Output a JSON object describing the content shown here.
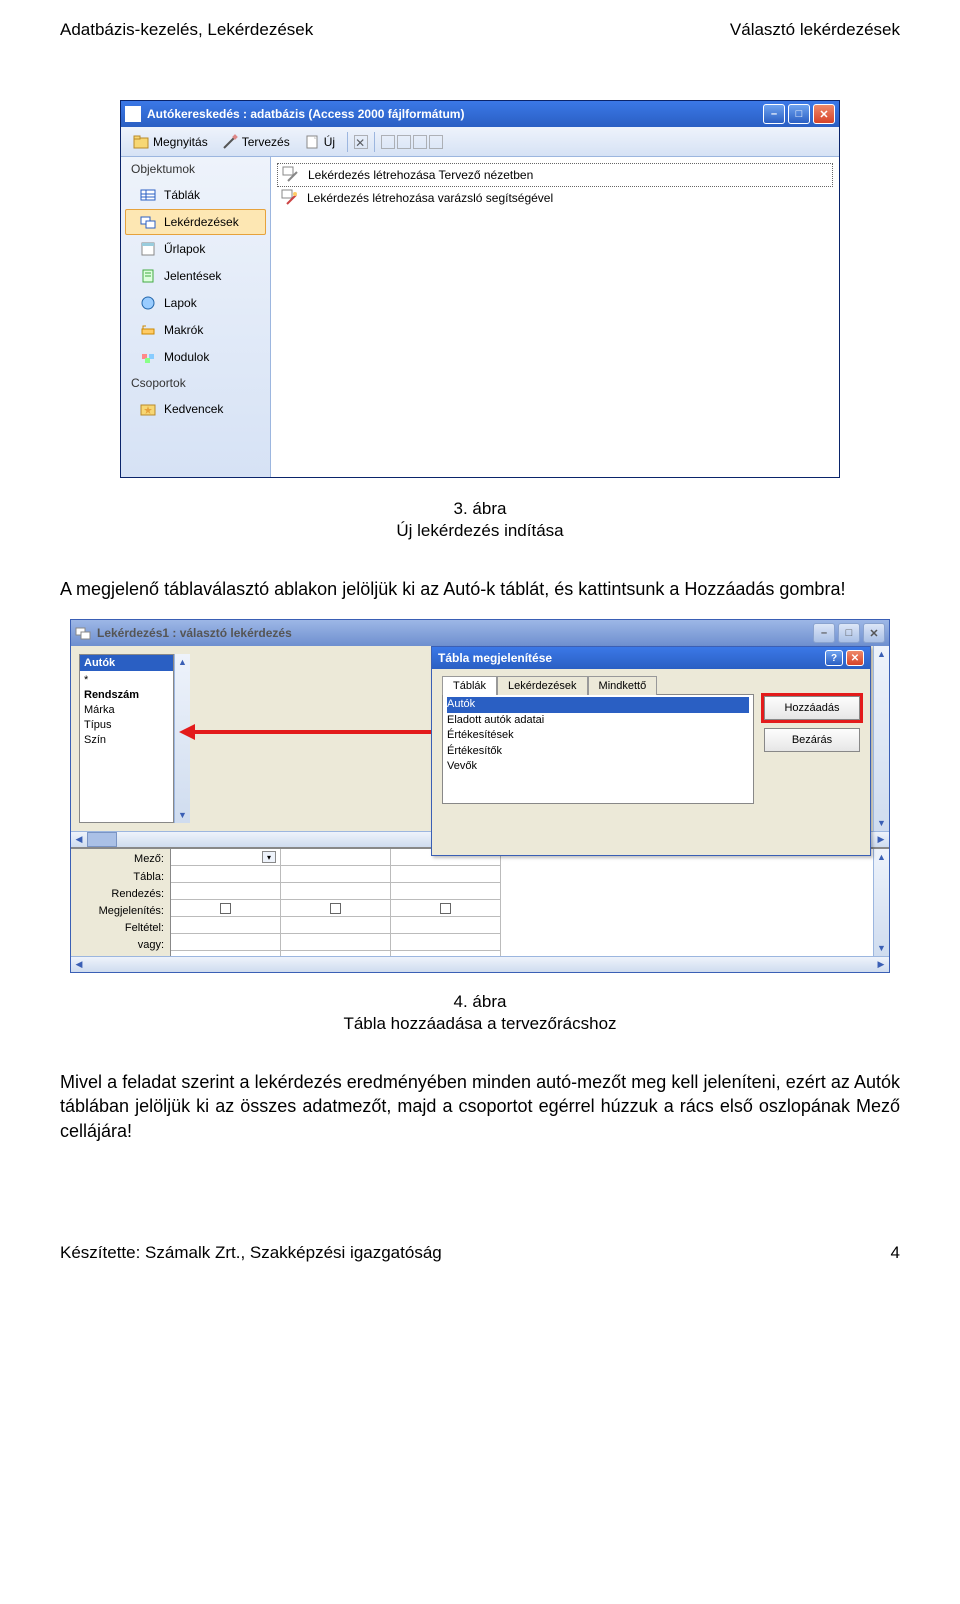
{
  "header": {
    "left": "Adatbázis-kezelés, Lekérdezések",
    "right": "Választó lekérdezések"
  },
  "win1": {
    "title": "Autókereskedés : adatbázis (Access 2000 fájlformátum)",
    "toolbar": {
      "open": "Megnyitás",
      "design": "Tervezés",
      "new": "Új"
    },
    "sidebar": {
      "hdr1": "Objektumok",
      "items": [
        "Táblák",
        "Lekérdezések",
        "Űrlapok",
        "Jelentések",
        "Lapok",
        "Makrók",
        "Modulok"
      ],
      "hdr2": "Csoportok",
      "fav": "Kedvencek"
    },
    "main": {
      "opt1": "Lekérdezés létrehozása Tervező nézetben",
      "opt2": "Lekérdezés létrehozása varázsló segítségével"
    }
  },
  "caption1": {
    "num": "3. ábra",
    "text": "Új lekérdezés indítása"
  },
  "para1": "A megjelenő táblaválasztó ablakon jelöljük ki az Autó-k táblát, és kattintsunk a Hozzáadás gombra!",
  "win2": {
    "title": "Lekérdezés1 : választó lekérdezés",
    "fieldlist": {
      "hdr": "Autók",
      "rows": [
        "*",
        "Rendszám",
        "Márka",
        "Típus",
        "Szín"
      ]
    },
    "dialog": {
      "title": "Tábla megjelenítése",
      "tabs": [
        "Táblák",
        "Lekérdezések",
        "Mindkettő"
      ],
      "list": [
        "Autók",
        "Eladott autók adatai",
        "Értékesítések",
        "Értékesítők",
        "Vevők"
      ],
      "btnAdd": "Hozzáadás",
      "btnClose": "Bezárás"
    },
    "gridlabels": [
      "Mező:",
      "Tábla:",
      "Rendezés:",
      "Megjelenítés:",
      "Feltétel:",
      "vagy:"
    ]
  },
  "caption2": {
    "num": "4. ábra",
    "text": "Tábla hozzáadása a tervezőrácshoz"
  },
  "para2": "Mivel a feladat szerint a lekérdezés eredményében minden autó-mezőt meg kell jeleníteni, ezért az Autók táblában jelöljük ki az összes adatmezőt, majd a csoportot egérrel húzzuk a rács első oszlopának Mező cellájára!",
  "footer": {
    "left": "Készítette: Számalk Zrt., Szakképzési igazgatóság",
    "right": "4"
  }
}
